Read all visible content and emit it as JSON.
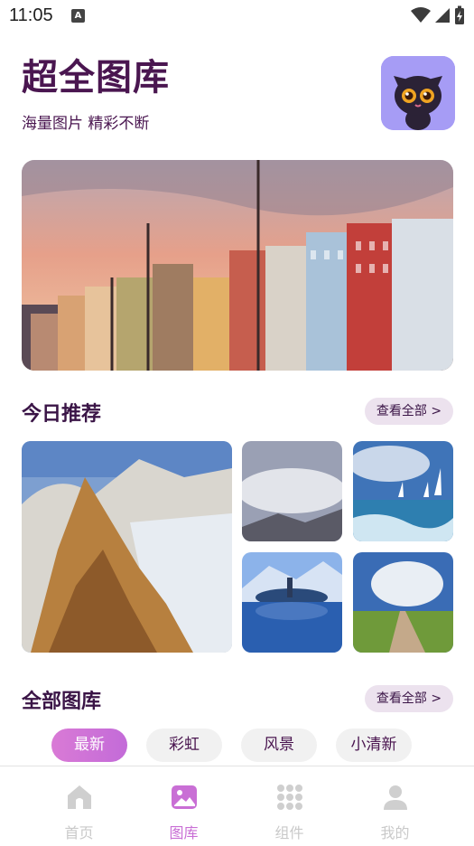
{
  "status_bar": {
    "time": "11:05",
    "notification_badge": "A"
  },
  "header": {
    "title": "超全图库",
    "subtitle": "海量图片 精彩不断"
  },
  "recommend": {
    "title_prefix": "今日",
    "title_highlight": "推荐",
    "more_label": "查看全部 >"
  },
  "gallery": {
    "title_prefix": "全部",
    "title_highlight": "图库",
    "more_label": "查看全部 >"
  },
  "filters": [
    {
      "label": "最新",
      "active": true
    },
    {
      "label": "彩虹",
      "active": false
    },
    {
      "label": "风景",
      "active": false
    },
    {
      "label": "小清新",
      "active": false
    }
  ],
  "tabs": [
    {
      "label": "首页",
      "icon": "home-icon",
      "active": false
    },
    {
      "label": "图库",
      "icon": "gallery-icon",
      "active": true
    },
    {
      "label": "组件",
      "icon": "grid-icon",
      "active": false
    },
    {
      "label": "我的",
      "icon": "user-icon",
      "active": false
    }
  ],
  "colors": {
    "accent": "#c96fd5",
    "title": "#4a1650",
    "highlight": "#f8d962"
  }
}
